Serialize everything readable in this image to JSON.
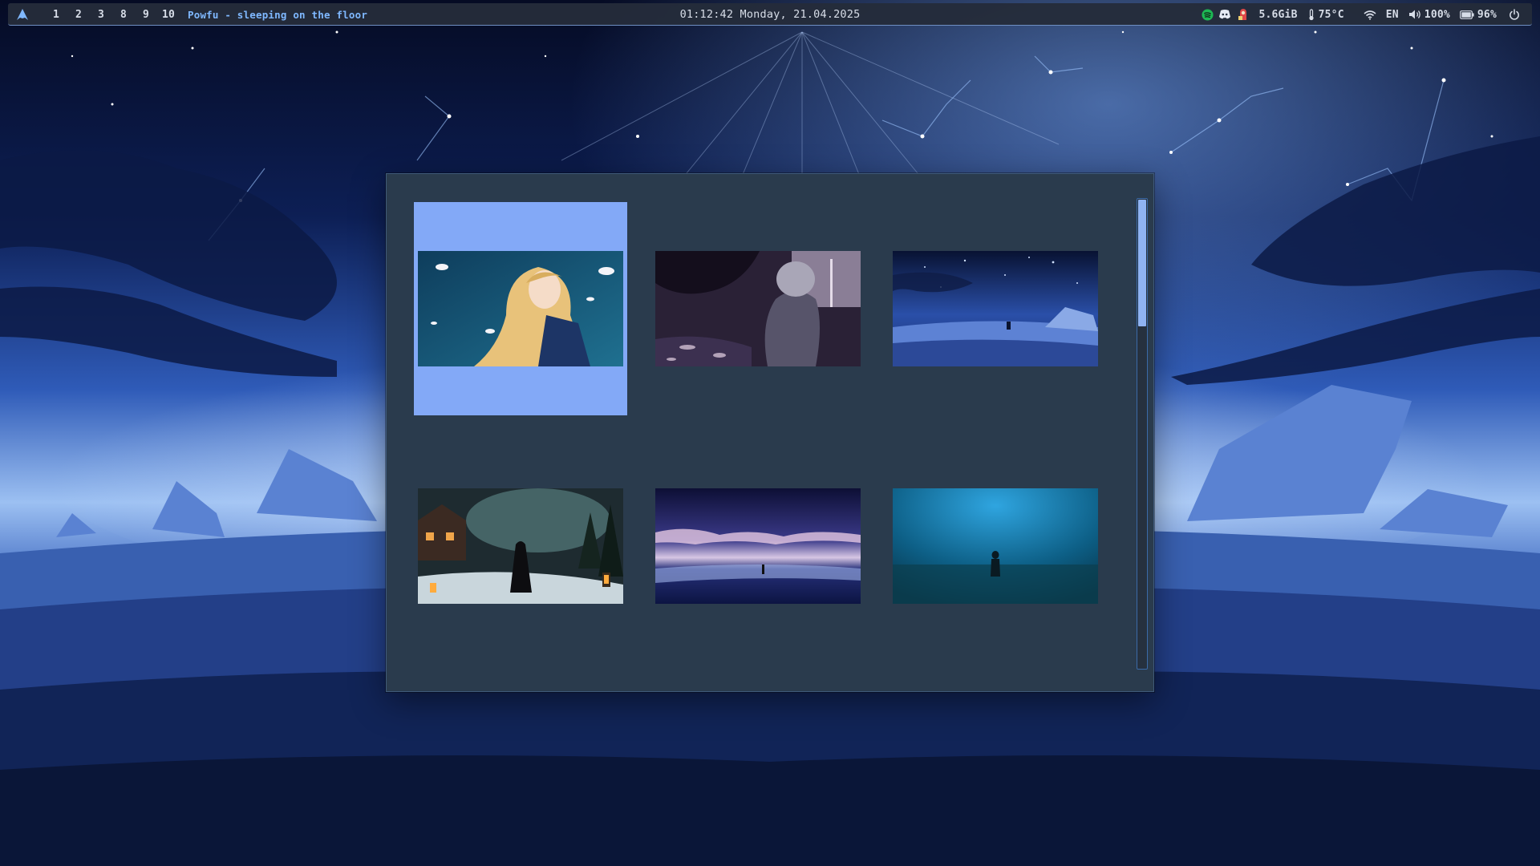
{
  "topbar": {
    "workspaces": [
      "1",
      "2",
      "3",
      "8",
      "9",
      "10"
    ],
    "now_playing": "Powfu - sleeping on the floor",
    "clock": "01:12:42 Monday, 21.04.2025",
    "memory": "5.6GiB",
    "temperature": "75°C",
    "keyboard_layout": "EN",
    "volume": "100%",
    "battery": "96%",
    "tray_icons": [
      "spotify-icon",
      "discord-icon",
      "app-tray-icon"
    ],
    "accent_color": "#7fb8ff"
  },
  "picker": {
    "selected_index": 0,
    "selection_color": "#83a9f7",
    "background_color": "#2a3b4d",
    "wallpapers": [
      {
        "subject": "anime girl with long blonde hair and falling petals"
      },
      {
        "subject": "grey-haired anime character in a shaded courtyard"
      },
      {
        "subject": "starry night over a snowy plain"
      },
      {
        "subject": "cloaked figure on a snowy village path with lanterns"
      },
      {
        "subject": "figure on a beach under a dramatic sunset sky"
      },
      {
        "subject": "lone figure standing in blue fog"
      }
    ],
    "scroll_fraction_visible": 0.27
  }
}
